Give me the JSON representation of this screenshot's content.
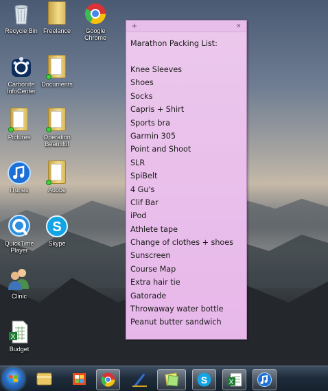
{
  "desktop_icons": [
    {
      "label": "Recycle Bin",
      "icon": "recycle-bin-icon"
    },
    {
      "label": "Freelance",
      "icon": "folder-icon"
    },
    {
      "label": "Google Chrome",
      "icon": "chrome-icon"
    },
    {
      "label": "Carbonite InfoCenter",
      "icon": "carbonite-icon"
    },
    {
      "label": "Documents",
      "icon": "folder-icon"
    },
    {
      "label": "Pictures",
      "icon": "folder-icon"
    },
    {
      "label": "Operation Beautiful",
      "icon": "folder-icon"
    },
    {
      "label": "iTunes",
      "icon": "itunes-icon"
    },
    {
      "label": "Adobe",
      "icon": "folder-icon"
    },
    {
      "label": "QuickTime Player",
      "icon": "quicktime-icon"
    },
    {
      "label": "Skype",
      "icon": "skype-icon"
    },
    {
      "label": "Clinic",
      "icon": "users-icon"
    },
    {
      "label": "Budget",
      "icon": "excel-file-icon"
    }
  ],
  "sticky_note": {
    "add_glyph": "+",
    "close_glyph": "×",
    "title": "Marathon Packing List:",
    "items": [
      "Knee Sleeves",
      "Shoes",
      "Socks",
      "Capris + Shirt",
      "Sports bra",
      "Garmin 305",
      "Point and Shoot",
      "SLR",
      "SpiBelt",
      "4 Gu's",
      "Clif Bar",
      "iPod",
      "Athlete tape",
      "Change of clothes + shoes",
      "Sunscreen",
      "Course Map",
      "Extra hair tie",
      "Gatorade",
      "Throwaway water bottle",
      "Peanut butter sandwich"
    ],
    "background_color": "#ecc8ec"
  },
  "taskbar": {
    "buttons": [
      {
        "name": "windows-explorer",
        "icon": "folder-icon"
      },
      {
        "name": "media-center",
        "icon": "media-icon"
      },
      {
        "name": "google-chrome",
        "icon": "chrome-icon"
      },
      {
        "name": "writer",
        "icon": "pen-icon"
      },
      {
        "name": "sticky-notes",
        "icon": "sticky-note-icon"
      },
      {
        "name": "skype",
        "icon": "skype-icon"
      },
      {
        "name": "excel",
        "icon": "excel-icon"
      },
      {
        "name": "itunes",
        "icon": "itunes-icon"
      }
    ]
  }
}
